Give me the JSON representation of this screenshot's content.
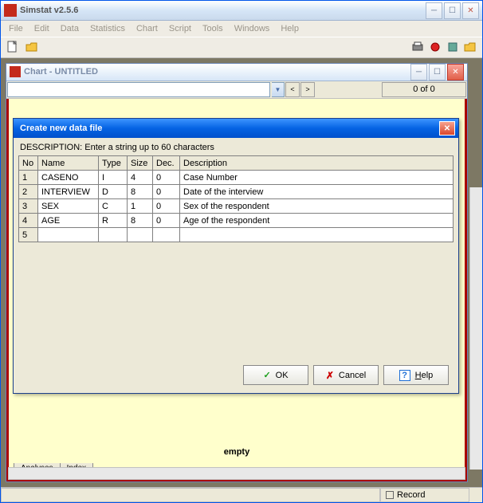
{
  "app": {
    "title": "Simstat v2.5.6"
  },
  "menu": {
    "file": "File",
    "edit": "Edit",
    "data": "Data",
    "statistics": "Statistics",
    "chart": "Chart",
    "script": "Script",
    "tools": "Tools",
    "windows": "Windows",
    "help": "Help"
  },
  "chart_window": {
    "title": "Chart - UNTITLED",
    "counter": "0 of 0",
    "empty": "empty",
    "tab1": "Analyses",
    "tab2": "Index"
  },
  "dialog": {
    "title": "Create new data file",
    "description": "DESCRIPTION: Enter a string up to 60 characters",
    "headers": {
      "no": "No",
      "name": "Name",
      "type": "Type",
      "size": "Size",
      "dec": "Dec.",
      "description": "Description"
    },
    "rows": [
      {
        "no": "1",
        "name": "CASENO",
        "type": "I",
        "size": "4",
        "dec": "0",
        "description": "Case Number"
      },
      {
        "no": "2",
        "name": "INTERVIEW",
        "type": "D",
        "size": "8",
        "dec": "0",
        "description": "Date of the interview"
      },
      {
        "no": "3",
        "name": "SEX",
        "type": "C",
        "size": "1",
        "dec": "0",
        "description": "Sex of the respondent"
      },
      {
        "no": "4",
        "name": "AGE",
        "type": "R",
        "size": "8",
        "dec": "0",
        "description": "Age of the respondent"
      },
      {
        "no": "5",
        "name": "",
        "type": "",
        "size": "",
        "dec": "",
        "description": ""
      }
    ],
    "buttons": {
      "ok": "OK",
      "cancel": "Cancel",
      "help": "Help"
    }
  },
  "status": {
    "record": "Record"
  }
}
